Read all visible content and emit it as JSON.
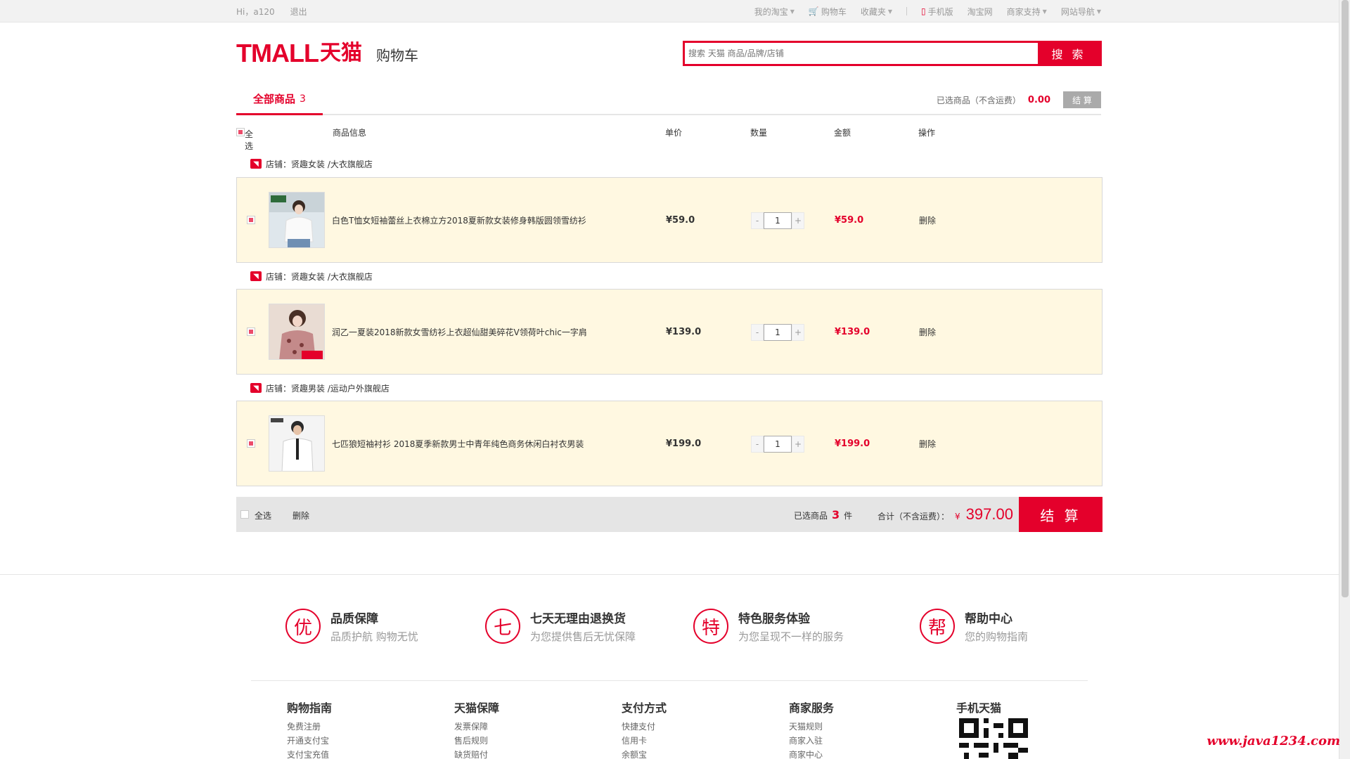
{
  "topbar": {
    "greeting": "Hi，a120",
    "logout": "退出",
    "links": [
      "我的淘宝",
      "购物车",
      "收藏夹",
      "手机版",
      "淘宝网",
      "商家支持",
      "网站导航"
    ]
  },
  "header": {
    "logo_en": "TMALL",
    "logo_cn": "天猫",
    "page_title": "购物车",
    "search_placeholder": "搜索 天猫 商品/品牌/店铺",
    "search_button": "搜 索"
  },
  "tabs": {
    "all_label": "全部商品",
    "all_count": "3",
    "selected_label": "已选商品（不含运费）",
    "selected_amount": "0.00",
    "checkout_small": "结 算"
  },
  "columns": {
    "select_all": "全选",
    "info": "商品信息",
    "unit_price": "单价",
    "quantity": "数量",
    "amount": "金额",
    "action": "操作"
  },
  "items": [
    {
      "shop": "店铺：贤趣女装 /大衣旗舰店",
      "name": "白色T恤女短袖蕾丝上衣棉立方2018夏新款女装修身韩版圆领雪纺衫",
      "price": "¥59.0",
      "qty": "1",
      "total": "¥59.0",
      "delete": "删除"
    },
    {
      "shop": "店铺：贤趣女装 /大衣旗舰店",
      "name": "润乙一夏装2018新款女雪纺衫上衣超仙甜美碎花V领荷叶chic一字肩",
      "price": "¥139.0",
      "qty": "1",
      "total": "¥139.0",
      "delete": "删除"
    },
    {
      "shop": "店铺：贤趣男装 /运动户外旗舰店",
      "name": "七匹狼短袖衬衫 2018夏季新款男士中青年纯色商务休闲白衬衣男装",
      "price": "¥199.0",
      "qty": "1",
      "total": "¥199.0",
      "delete": "删除"
    }
  ],
  "bottom": {
    "select_all": "全选",
    "delete": "删除",
    "selected_prefix": "已选商品",
    "selected_count": "3",
    "selected_unit": "件",
    "total_label": "合计（不含运费）：",
    "currency": "¥",
    "total_amount": "397.00",
    "checkout": "结 算"
  },
  "guarantees": [
    {
      "glyph": "优",
      "title": "品质保障",
      "sub": "品质护航 购物无忧"
    },
    {
      "glyph": "七",
      "title": "七天无理由退换货",
      "sub": "为您提供售后无忧保障"
    },
    {
      "glyph": "特",
      "title": "特色服务体验",
      "sub": "为您呈现不一样的服务"
    },
    {
      "glyph": "帮",
      "title": "帮助中心",
      "sub": "您的购物指南"
    }
  ],
  "footer": [
    {
      "title": "购物指南",
      "items": [
        "免费注册",
        "开通支付宝",
        "支付宝充值"
      ]
    },
    {
      "title": "天猫保障",
      "items": [
        "发票保障",
        "售后规则",
        "缺货赔付"
      ]
    },
    {
      "title": "支付方式",
      "items": [
        "快捷支付",
        "信用卡",
        "余额宝"
      ]
    },
    {
      "title": "商家服务",
      "items": [
        "天猫规则",
        "商家入驻",
        "商家中心"
      ]
    },
    {
      "title": "手机天猫",
      "items": []
    }
  ],
  "watermark": "www.java1234.com",
  "colors": {
    "accent": "#e4002b",
    "row_bg": "#fff8e1"
  }
}
